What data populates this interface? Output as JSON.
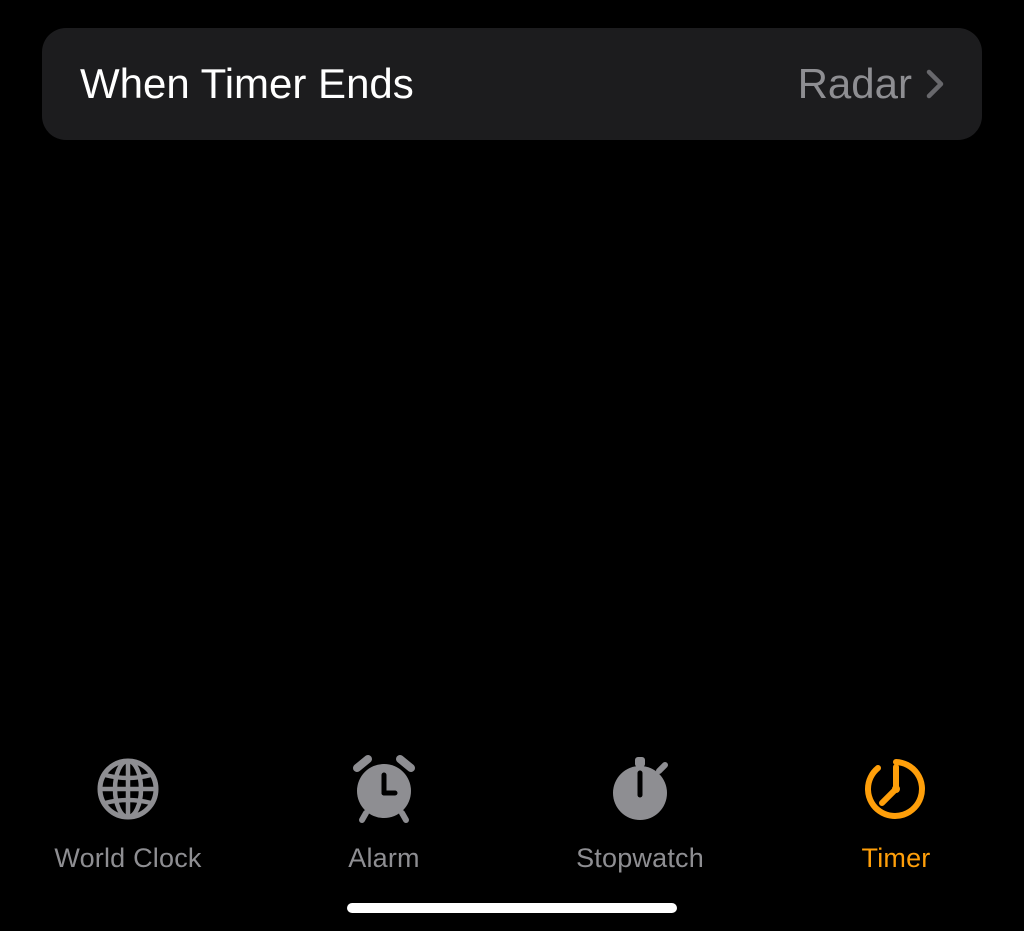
{
  "settings": {
    "label": "When Timer Ends",
    "value": "Radar"
  },
  "tabs": [
    {
      "label": "World Clock",
      "active": false
    },
    {
      "label": "Alarm",
      "active": false
    },
    {
      "label": "Stopwatch",
      "active": false
    },
    {
      "label": "Timer",
      "active": true
    }
  ],
  "colors": {
    "inactive": "#8e8e92",
    "active": "#ff9f0a"
  }
}
